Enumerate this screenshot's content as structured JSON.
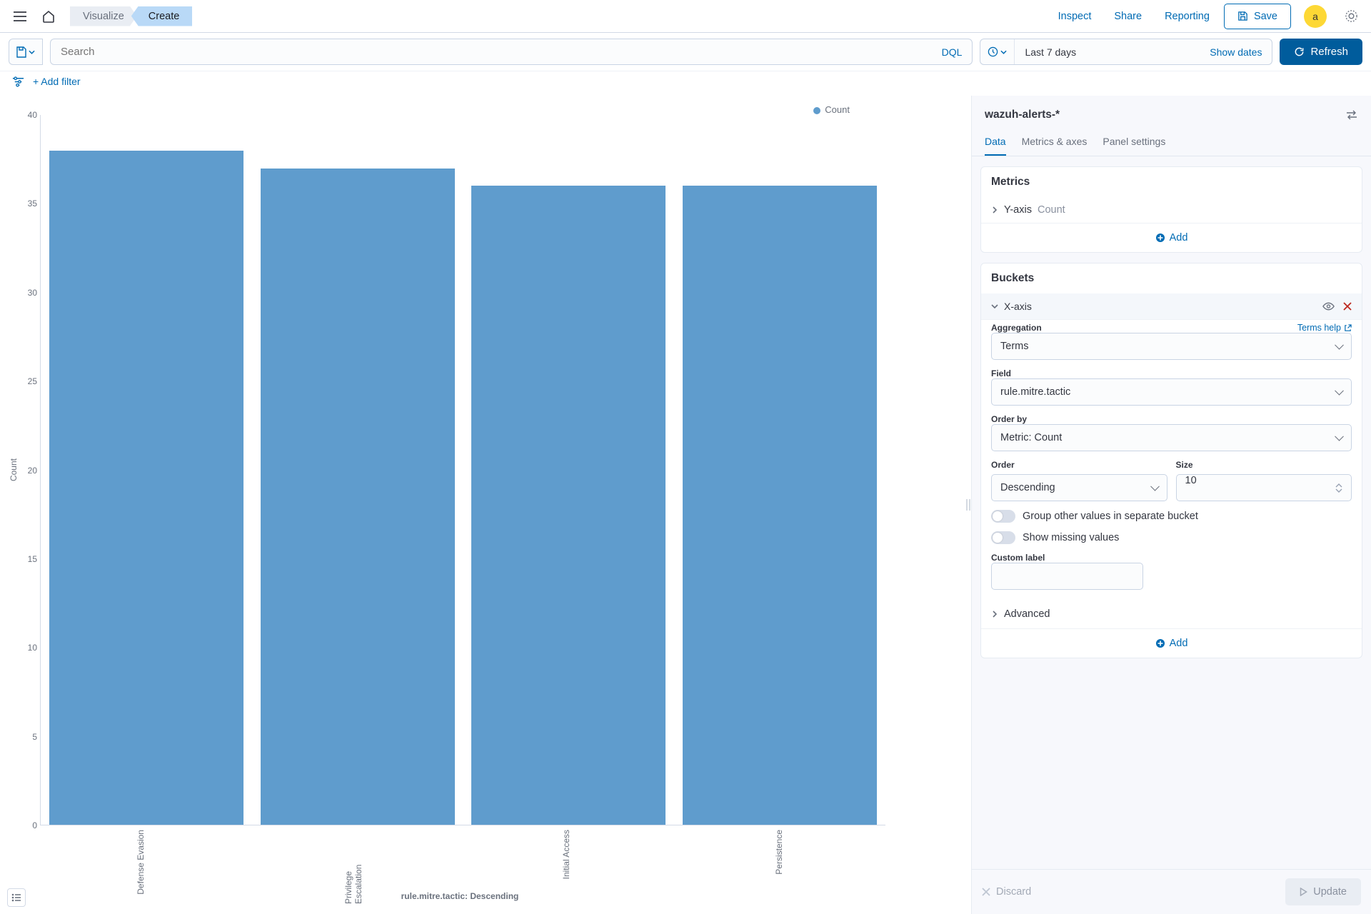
{
  "header": {
    "breadcrumb1": "Visualize",
    "breadcrumb2": "Create",
    "inspect": "Inspect",
    "share": "Share",
    "reporting": "Reporting",
    "save": "Save",
    "avatar": "a"
  },
  "query": {
    "search_placeholder": "Search",
    "dql": "DQL",
    "date_range": "Last 7 days",
    "show_dates": "Show dates",
    "refresh": "Refresh"
  },
  "filter": {
    "add_filter": "+ Add filter"
  },
  "legend": {
    "count": "Count"
  },
  "yaxis_label": "Count",
  "xaxis_label": "rule.mitre.tactic: Descending",
  "yticks": {
    "t0": "0",
    "t5": "5",
    "t10": "10",
    "t15": "15",
    "t20": "20",
    "t25": "25",
    "t30": "30",
    "t35": "35",
    "t40": "40"
  },
  "side": {
    "index_pattern": "wazuh-alerts-*",
    "tabs": {
      "data": "Data",
      "metrics": "Metrics & axes",
      "panel": "Panel settings"
    },
    "metrics": {
      "title": "Metrics",
      "yaxis": "Y-axis",
      "yaxis_sub": "Count",
      "add": "Add"
    },
    "buckets": {
      "title": "Buckets",
      "xaxis": "X-axis",
      "aggregation_label": "Aggregation",
      "terms_help": "Terms help",
      "aggregation_value": "Terms",
      "field_label": "Field",
      "field_value": "rule.mitre.tactic",
      "orderby_label": "Order by",
      "orderby_value": "Metric: Count",
      "order_label": "Order",
      "order_value": "Descending",
      "size_label": "Size",
      "size_value": "10",
      "group_other": "Group other values in separate bucket",
      "show_missing": "Show missing values",
      "custom_label": "Custom label",
      "advanced": "Advanced",
      "add": "Add"
    },
    "footer": {
      "discard": "Discard",
      "update": "Update"
    }
  },
  "chart_data": {
    "type": "bar",
    "categories": [
      "Defense Evasion",
      "Privilege Escalation",
      "Initial Access",
      "Persistence"
    ],
    "values": [
      38,
      37,
      36,
      36
    ],
    "title": "",
    "xlabel": "rule.mitre.tactic: Descending",
    "ylabel": "Count",
    "ylim": [
      0,
      40
    ],
    "series": [
      {
        "name": "Count",
        "color": "#5f9ccd"
      }
    ]
  }
}
